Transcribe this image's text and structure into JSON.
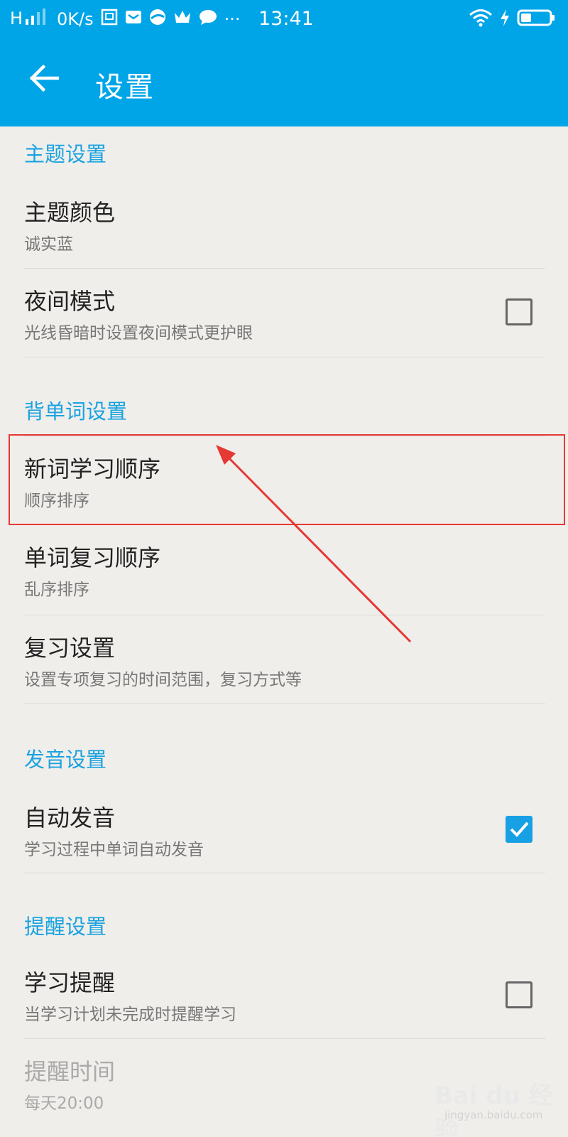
{
  "status_bar": {
    "signal_text": "H",
    "net_speed": "0K/s",
    "time": "13:41",
    "more": "···"
  },
  "app_bar": {
    "title": "设置",
    "back_icon": "arrow-left-icon"
  },
  "sections": [
    {
      "header": "主题设置",
      "items": [
        {
          "title": "主题颜色",
          "subtitle": "诚实蓝"
        },
        {
          "title": "夜间模式",
          "subtitle": "光线昏暗时设置夜间模式更护眼",
          "checkbox": false
        }
      ]
    },
    {
      "header": "背单词设置",
      "items": [
        {
          "title": "新词学习顺序",
          "subtitle": "顺序排序"
        },
        {
          "title": "单词复习顺序",
          "subtitle": "乱序排序"
        },
        {
          "title": "复习设置",
          "subtitle": "设置专项复习的时间范围，复习方式等"
        }
      ]
    },
    {
      "header": "发音设置",
      "items": [
        {
          "title": "自动发音",
          "subtitle": "学习过程中单词自动发音",
          "checkbox": true
        }
      ]
    },
    {
      "header": "提醒设置",
      "items": [
        {
          "title": "学习提醒",
          "subtitle": "当学习计划未完成时提醒学习",
          "checkbox": false
        },
        {
          "title": "提醒时间",
          "subtitle": "每天20:00",
          "disabled": true
        }
      ]
    }
  ],
  "watermark": {
    "text": "Bai du 经验",
    "sub": "jingyan.baidu.com"
  },
  "colors": {
    "accent": "#00a5e8",
    "highlight": "#e53935",
    "background": "#f0eeeb"
  }
}
